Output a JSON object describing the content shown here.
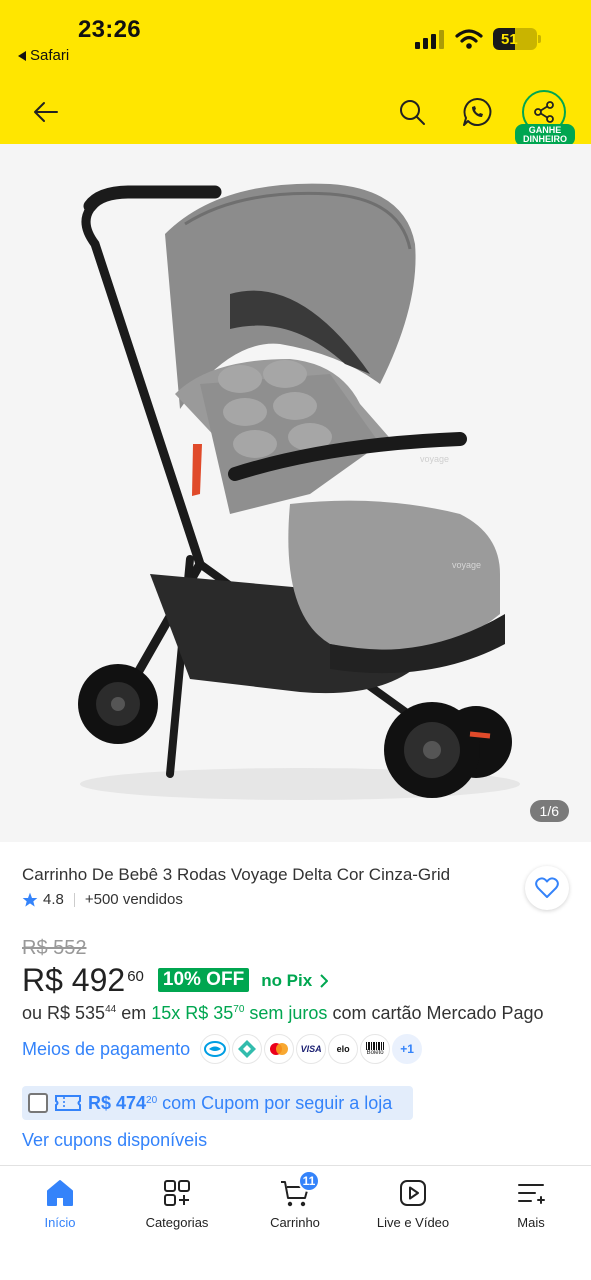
{
  "status_bar": {
    "time": "23:26",
    "back_app": "Safari",
    "battery_level": "51",
    "battery_fraction": 0.51
  },
  "app_bar": {
    "icons": [
      "back-arrow-icon",
      "search-icon",
      "whatsapp-icon",
      "share-icon"
    ],
    "share_label": "GANHE DINHEIRO",
    "colors": {
      "background": "#ffe600",
      "share_accent": "#00a650"
    }
  },
  "gallery": {
    "counter": "1/6",
    "image_subject": "Carrinho de bebê 3 rodas cinza",
    "product_brand_mark": "voyage"
  },
  "product": {
    "title": "Carrinho De Bebê 3 Rodas Voyage Delta Cor Cinza-Grid",
    "rating": "4.8",
    "sold": "+500 vendidos",
    "old_price": "R$ 552",
    "price_whole": "R$ 492",
    "price_cents": "60",
    "discount": "10% OFF",
    "pix_label": "no Pix",
    "installments": {
      "prefix": "ou R$ 535",
      "prefix_cents": "44",
      "middle": " em ",
      "plan": "15x R$ 35",
      "plan_cents": "70",
      "interest": " sem juros",
      "suffix": " com cartão Mercado Pago"
    },
    "payment_link": "Meios de pagamento",
    "payment_icons": [
      "mercado-pago-icon",
      "pix-icon",
      "mastercard-icon",
      "visa-icon",
      "elo-icon",
      "boleto-icon"
    ],
    "payment_more": "+1",
    "visa_text": "VISA",
    "elo_text": "elo",
    "boleto_text": "Boleto",
    "coupon": {
      "price": "R$ 474",
      "price_cents": "20",
      "text": " com Cupom por seguir a loja"
    },
    "coupons_link": "Ver cupons disponíveis"
  },
  "bottom_nav": {
    "items": [
      {
        "label": "Início",
        "icon": "home-icon",
        "active": true
      },
      {
        "label": "Categorias",
        "icon": "categories-icon",
        "active": false
      },
      {
        "label": "Carrinho",
        "icon": "cart-icon",
        "active": false,
        "badge": "11"
      },
      {
        "label": "Live e Vídeo",
        "icon": "play-icon",
        "active": false
      },
      {
        "label": "Mais",
        "icon": "menu-icon",
        "active": false
      }
    ],
    "colors": {
      "active": "#3483fa"
    }
  }
}
